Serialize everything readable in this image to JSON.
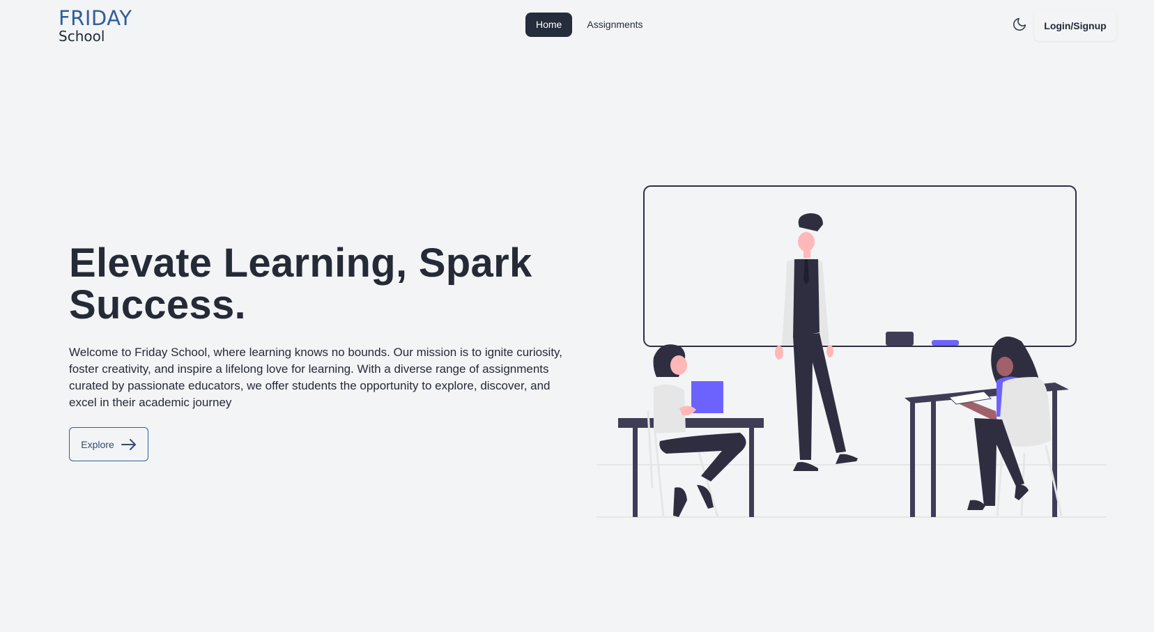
{
  "header": {
    "logo_top": "FRIDAY",
    "logo_bottom": "School",
    "nav": [
      {
        "label": "Home",
        "active": true
      },
      {
        "label": "Assignments",
        "active": false
      }
    ],
    "theme_icon": "moon-icon",
    "login_label": "Login/Signup"
  },
  "hero": {
    "title_line1": "Elevate Learning, Spark",
    "title_line2": "Success.",
    "description": "Welcome to Friday School, where learning knows no bounds. Our mission is to ignite curiosity, foster creativity, and inspire a lifelong love for learning. With a diverse range of assignments curated by passionate educators, we offer students the opportunity to explore, discover, and excel in their academic journey",
    "explore_label": "Explore",
    "explore_icon": "arrow-right-icon"
  },
  "colors": {
    "brand": "#2f5f98",
    "dark": "#252c3b",
    "background": "#f3f4f6",
    "accent": "#6c63ff"
  }
}
